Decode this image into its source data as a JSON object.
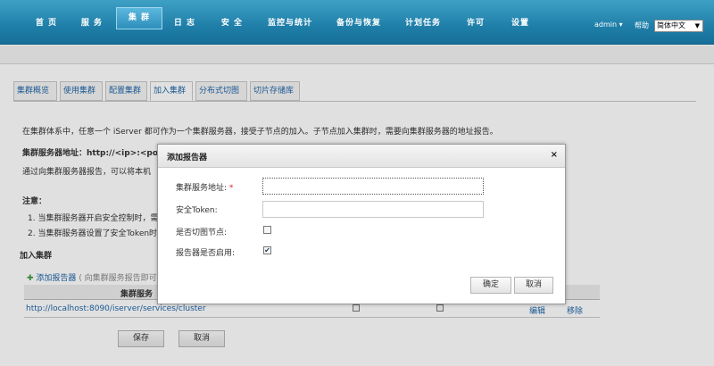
{
  "nav": {
    "items": [
      "首 页",
      "服 务",
      "集 群",
      "日 志",
      "安 全",
      "监控与统计",
      "备份与恢复",
      "计划任务",
      "许可",
      "设置"
    ],
    "active_index": 2,
    "user": "admin ▾",
    "help": "帮助",
    "language": "简体中文"
  },
  "tabs": [
    "集群概览",
    "使用集群",
    "配置集群",
    "加入集群",
    "分布式切图",
    "切片存储库"
  ],
  "active_tab": 3,
  "page": {
    "intro": "在集群体系中，任意一个 iServer 都可作为一个集群服务器，接受子节点的加入。子节点加入集群时，需要向集群服务器的地址报告。",
    "server_addr_prefix": "集群服务器地址：http://<ip>:<po",
    "report_text": "通过向集群服务器报告，可以将本机",
    "note_title": "注意：",
    "note_1": "1. 当集群服务器开启安全控制时，需",
    "note_2": "2. 当集群服务器设置了安全Token时",
    "join_title": "加入集群",
    "add_reporter": "添加报告器",
    "add_reporter_hint": "( 向集群服务报告即可",
    "table_header": "集群服务",
    "row_url": "http://localhost:8090/iserver/services/cluster",
    "row_edit": "编辑",
    "row_remove": "移除",
    "save": "保存",
    "cancel": "取消"
  },
  "dialog": {
    "title": "添加报告器",
    "close": "×",
    "server_label": "集群服务地址:",
    "required_mark": "*",
    "token_label": "安全Token:",
    "tile_node_label": "是否切图节点:",
    "enabled_label": "报告器是否启用:",
    "ok": "确定",
    "cancel": "取消"
  }
}
